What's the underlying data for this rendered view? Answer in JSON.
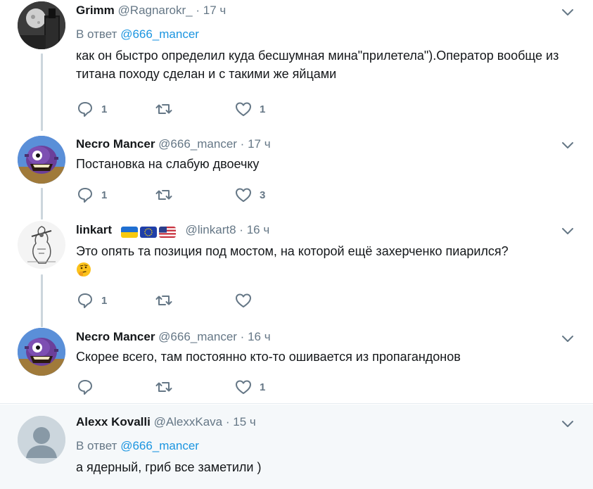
{
  "tweets": [
    {
      "name": "Grimm",
      "handle": "@Ragnarokr_",
      "dot": "·",
      "time": "17 ч",
      "reply_label": "В ответ",
      "reply_mention": "@666_mancer",
      "text": "как он быстро определил куда бесшумная мина\"прилетела\").Оператор вообще из титана походу сделан и с такими же яйцами",
      "replies": "1",
      "retweets": "",
      "likes": "1"
    },
    {
      "name": "Necro Mancer",
      "handle": "@666_mancer",
      "dot": "·",
      "time": "17 ч",
      "text": "Постановка на слабую двоечку",
      "replies": "1",
      "retweets": "",
      "likes": "3"
    },
    {
      "name": "linkart",
      "handle": "@linkart8",
      "dot": "·",
      "time": "16 ч",
      "text": "Это опять та позиция под мостом, на которой ещё захерченко пиарился?",
      "replies": "1",
      "retweets": "",
      "likes": ""
    },
    {
      "name": "Necro Mancer",
      "handle": "@666_mancer",
      "dot": "·",
      "time": "16 ч",
      "text": "Скорее всего, там постоянно кто-то ошивается из пропагандонов",
      "replies": "",
      "retweets": "",
      "likes": "1"
    },
    {
      "name": "Alexx Kovalli",
      "handle": "@AlexxKava",
      "dot": "·",
      "time": "15 ч",
      "reply_label": "В ответ",
      "reply_mention": "@666_mancer",
      "text": "а ядерный, гриб все заметили )"
    }
  ],
  "flags": [
    "ukraine-flag",
    "eu-flag",
    "usa-flag"
  ],
  "colors": {
    "accent": "#1b95e0",
    "secondary_text": "#657786",
    "thread_line": "#ccd6dd",
    "highlight_bg": "#f5f8fa"
  }
}
